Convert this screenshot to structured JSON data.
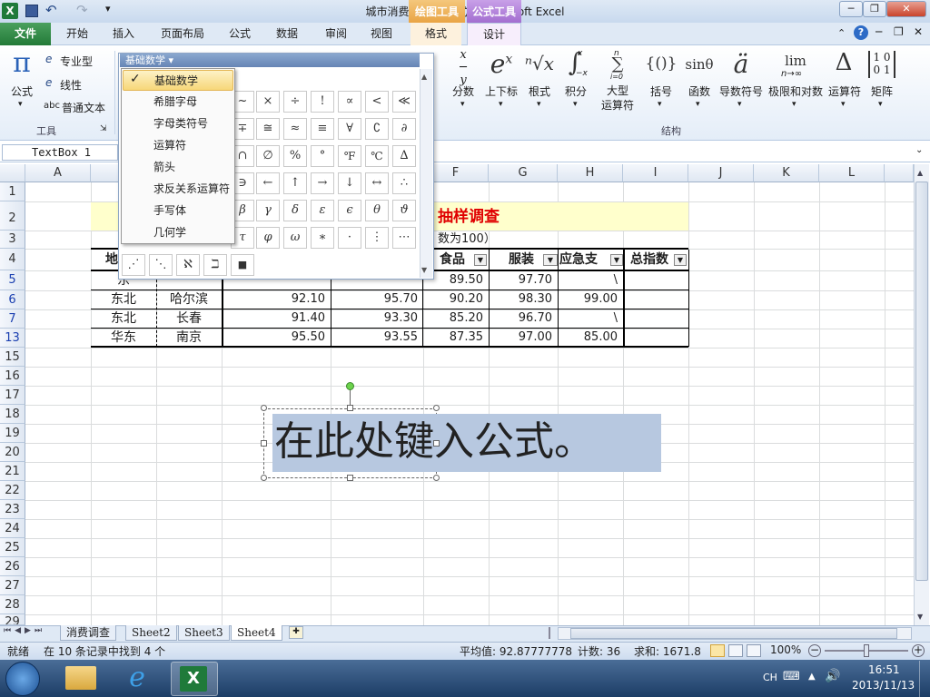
{
  "window": {
    "title": "城市消费1  [兼容模式] - Microsoft Excel",
    "context_tab_drawing": "绘图工具",
    "context_tab_formula": "公式工具",
    "min": "─",
    "restore": "❐",
    "close": "✕"
  },
  "tabs": [
    "文件",
    "开始",
    "插入",
    "页面布局",
    "公式",
    "数据",
    "审阅",
    "视图",
    "格式",
    "设计"
  ],
  "ribbon": {
    "formula_label": "公式",
    "tools": [
      "专业型",
      "线性",
      "普通文本"
    ],
    "tools_group": "工具",
    "abc": "abc",
    "structure_group": "结构",
    "structures": [
      {
        "icon": "x/y",
        "label": "分数"
      },
      {
        "icon": "eˣ",
        "label": "上下标"
      },
      {
        "icon": "ⁿ√x",
        "label": "根式"
      },
      {
        "icon": "∫",
        "label": "积分"
      },
      {
        "icon": "∑",
        "label": "大型\n运算符"
      },
      {
        "icon": "{()}",
        "label": "括号"
      },
      {
        "icon": "sinθ",
        "label": "函数"
      },
      {
        "icon": "ä",
        "label": "导数符号"
      },
      {
        "icon": "lim",
        "label": "极限和对数"
      },
      {
        "icon": "Δ",
        "label": "运算符"
      },
      {
        "icon": "[10/01]",
        "label": "矩阵"
      }
    ],
    "lim_sub": "n→∞",
    "integral_sub": "−x",
    "integral_sup": "x",
    "sum_sub": "i=0",
    "sum_sup": "n"
  },
  "namebox": "TextBox 1",
  "columns": [
    "A",
    "B",
    "C",
    "D",
    "E",
    "F",
    "G",
    "H",
    "I",
    "J",
    "K",
    "L"
  ],
  "rows": [
    "1",
    "2",
    "3",
    "4",
    "5",
    "6",
    "7",
    "13",
    "15",
    "16",
    "17",
    "18",
    "19",
    "20",
    "21",
    "22",
    "23",
    "24",
    "25",
    "26",
    "27",
    "28",
    "29"
  ],
  "sheet": {
    "title_partial": "抽样调查",
    "subtitle_partial": "数为100）",
    "headers_visible": [
      "地",
      "食品",
      "服装",
      "应急支",
      "总指数"
    ],
    "table_rows": [
      {
        "region": "东",
        "city": "",
        "d": "",
        "e": "",
        "f": "89.50",
        "g": "97.70",
        "h": "\\"
      },
      {
        "region": "东北",
        "city": "哈尔滨",
        "d": "92.10",
        "e": "95.70",
        "f": "90.20",
        "g": "98.30",
        "h": "99.00"
      },
      {
        "region": "东北",
        "city": "长春",
        "d": "91.40",
        "e": "93.30",
        "f": "85.20",
        "g": "96.70",
        "h": "\\"
      },
      {
        "region": "华东",
        "city": "南京",
        "d": "95.50",
        "e": "93.55",
        "f": "87.35",
        "g": "97.00",
        "h": "85.00"
      }
    ]
  },
  "equation_text": "在此处键入公式。",
  "symbol_panel": {
    "header": "基础数学 ▾",
    "menu": [
      "基础数学",
      "希腊字母",
      "字母类符号",
      "运算符",
      "箭头",
      "求反关系运算符",
      "手写体",
      "几何学"
    ],
    "check": "✓",
    "grid": [
      [
        "~",
        "×",
        "÷",
        "!",
        "∝",
        "<",
        "≪"
      ],
      [
        "∓",
        "≅",
        "≈",
        "≡",
        "∀",
        "∁",
        "∂"
      ],
      [
        "∩",
        "∅",
        "%",
        "°",
        "℉",
        "℃",
        "∆"
      ],
      [
        "∋",
        "←",
        "↑",
        "→",
        "↓",
        "↔",
        "∴"
      ],
      [
        "β",
        "γ",
        "δ",
        "ε",
        "ϵ",
        "θ",
        "ϑ"
      ],
      [
        "τ",
        "φ",
        "ω",
        "∗",
        "·",
        "⋮",
        "⋯"
      ]
    ],
    "last_row": [
      "⋰",
      "⋱",
      "ℵ",
      "ℶ",
      "■"
    ]
  },
  "sheet_tabs": [
    "消费调查",
    "Sheet2",
    "Sheet3",
    "Sheet4"
  ],
  "status": {
    "ready": "就绪",
    "found": "在 10 条记录中找到 4 个",
    "average": "平均值: 92.87777778",
    "count": "计数: 36",
    "sum": "求和: 1671.8",
    "zoom": "100%"
  },
  "taskbar": {
    "lang": "CH",
    "time": "16:51",
    "date": "2013/11/13"
  },
  "colors": {
    "title_red": "#e00000",
    "header_yellow": "#ffffcc",
    "selection": "#b7c8e0"
  }
}
